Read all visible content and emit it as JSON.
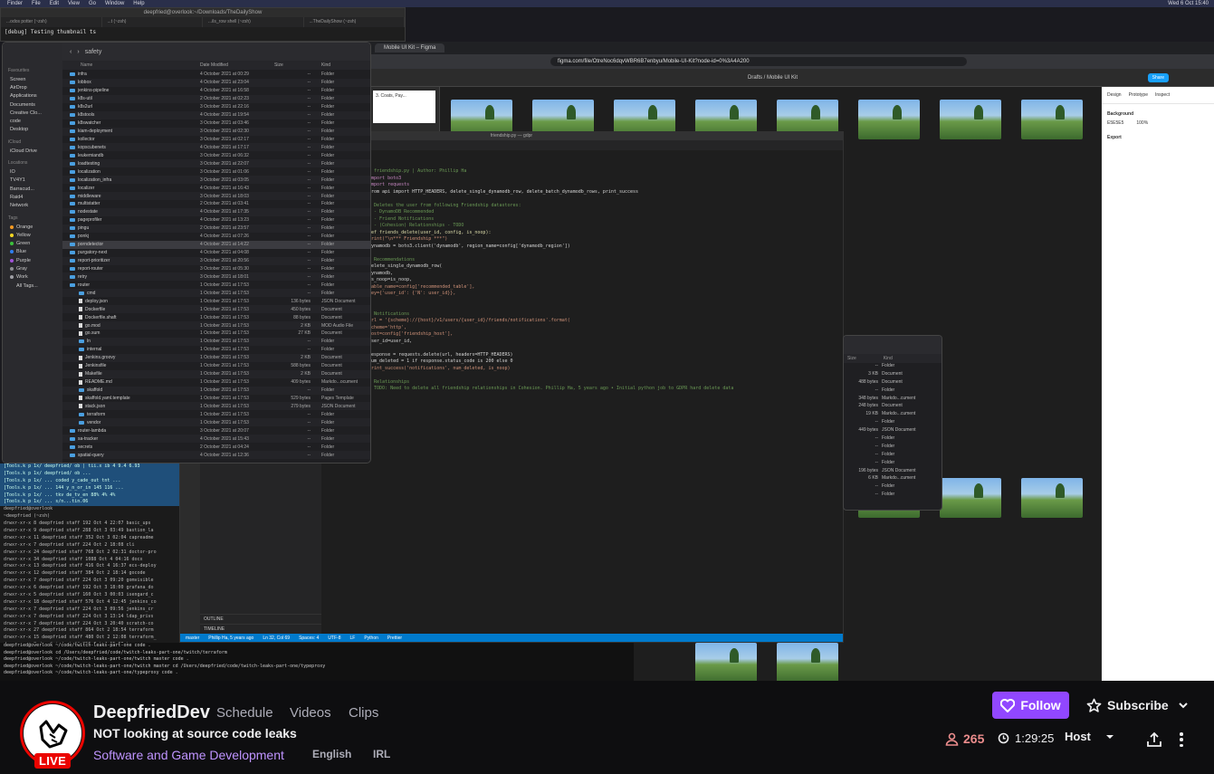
{
  "stream": {
    "menubar": {
      "items": [
        "Finder",
        "File",
        "Edit",
        "View",
        "Go",
        "Window",
        "Help"
      ],
      "clock": "Wed 6 Oct 15:40"
    },
    "terminal_top": {
      "title": "deepfried@overlook:~/Downloads/TheDailyShow",
      "tabs": [
        "...odos  potter (~zsh)",
        "...t (~zsh)",
        "...ils_row  shell (~zsh)",
        "...TheDailyShow (~zsh)"
      ],
      "line": "[debug] Testing thumbnail ts"
    },
    "finder": {
      "folder": "safety",
      "sidebar": {
        "favorites_label": "Favourites",
        "favorites": [
          "Screen",
          "AirDrop",
          "Applications",
          "Documents",
          "Creative Clo...",
          "code",
          "Desktop"
        ],
        "icloud_label": "iCloud",
        "icloud": [
          "iCloud Drive"
        ],
        "locations_label": "Locations",
        "locations": [
          "IO",
          "TV4Y1",
          "Barracud...",
          "Raid4",
          "Network"
        ],
        "tags_label": "Tags",
        "tags": [
          {
            "name": "Orange",
            "color": "#f59a23"
          },
          {
            "name": "Yellow",
            "color": "#f5d623"
          },
          {
            "name": "Green",
            "color": "#3cc13c"
          },
          {
            "name": "Blue",
            "color": "#2f7ff0"
          },
          {
            "name": "Purple",
            "color": "#a052d8"
          },
          {
            "name": "Gray",
            "color": "#8e8e93"
          },
          {
            "name": "Work",
            "color": "#9e9ea4"
          },
          {
            "name": "All Tags...",
            "color": ""
          }
        ]
      },
      "columns": [
        "Name",
        "Date Modified",
        "Size",
        "Kind"
      ],
      "rows": [
        {
          "name": "infra",
          "date": "4 October 2021 at 00:29",
          "size": "--",
          "kind": "Folder",
          "type": "folder"
        },
        {
          "name": "lobbox",
          "date": "4 October 2021 at 23:04",
          "size": "--",
          "kind": "Folder",
          "type": "folder"
        },
        {
          "name": "jenkins-pipeline",
          "date": "4 October 2021 at 16:58",
          "size": "--",
          "kind": "Folder",
          "type": "folder"
        },
        {
          "name": "k8s-util",
          "date": "2 October 2021 at 02:23",
          "size": "--",
          "kind": "Folder",
          "type": "folder"
        },
        {
          "name": "k8s2url",
          "date": "3 October 2021 at 22:16",
          "size": "--",
          "kind": "Folder",
          "type": "folder"
        },
        {
          "name": "k8stools",
          "date": "4 October 2021 at 19:54",
          "size": "--",
          "kind": "Folder",
          "type": "folder"
        },
        {
          "name": "k8swatcher",
          "date": "3 October 2021 at 03:46",
          "size": "--",
          "kind": "Folder",
          "type": "folder"
        },
        {
          "name": "kiam-deployment",
          "date": "3 October 2021 at 02:30",
          "size": "--",
          "kind": "Folder",
          "type": "folder"
        },
        {
          "name": "kollector",
          "date": "3 October 2021 at 02:17",
          "size": "--",
          "kind": "Folder",
          "type": "folder"
        },
        {
          "name": "kopscubenets",
          "date": "4 October 2021 at 17:17",
          "size": "--",
          "kind": "Folder",
          "type": "folder"
        },
        {
          "name": "leukemiandb",
          "date": "3 October 2021 at 06:32",
          "size": "--",
          "kind": "Folder",
          "type": "folder"
        },
        {
          "name": "loadtesting",
          "date": "3 October 2021 at 22:07",
          "size": "--",
          "kind": "Folder",
          "type": "folder"
        },
        {
          "name": "localization",
          "date": "3 October 2021 at 01:06",
          "size": "--",
          "kind": "Folder",
          "type": "folder"
        },
        {
          "name": "localization_infra",
          "date": "3 October 2021 at 03:05",
          "size": "--",
          "kind": "Folder",
          "type": "folder"
        },
        {
          "name": "localizer",
          "date": "4 October 2021 at 16:43",
          "size": "--",
          "kind": "Folder",
          "type": "folder"
        },
        {
          "name": "middleware",
          "date": "3 October 2021 at 18:03",
          "size": "--",
          "kind": "Folder",
          "type": "folder"
        },
        {
          "name": "multistatter",
          "date": "2 October 2021 at 03:41",
          "size": "--",
          "kind": "Folder",
          "type": "folder"
        },
        {
          "name": "nodestate",
          "date": "4 October 2021 at 17:35",
          "size": "--",
          "kind": "Folder",
          "type": "folder"
        },
        {
          "name": "pageprofiler",
          "date": "4 October 2021 at 13:23",
          "size": "--",
          "kind": "Folder",
          "type": "folder"
        },
        {
          "name": "pingu",
          "date": "2 October 2021 at 23:57",
          "size": "--",
          "kind": "Folder",
          "type": "folder"
        },
        {
          "name": "ponkj",
          "date": "4 October 2021 at 07:26",
          "size": "--",
          "kind": "Folder",
          "type": "folder"
        },
        {
          "name": "porndetector",
          "date": "4 October 2021 at 14:22",
          "size": "--",
          "kind": "Folder",
          "type": "folder"
        },
        {
          "name": "purgatory-next",
          "date": "4 October 2021 at 04:08",
          "size": "--",
          "kind": "Folder",
          "type": "folder"
        },
        {
          "name": "report-prioritizer",
          "date": "3 October 2021 at 20:56",
          "size": "--",
          "kind": "Folder",
          "type": "folder"
        },
        {
          "name": "report-router",
          "date": "3 October 2021 at 05:30",
          "size": "--",
          "kind": "Folder",
          "type": "folder"
        },
        {
          "name": "retry",
          "date": "3 October 2021 at 18:01",
          "size": "--",
          "kind": "Folder",
          "type": "folder"
        },
        {
          "name": "router",
          "date": "1 October 2021 at 17:53",
          "size": "--",
          "kind": "Folder",
          "type": "folder"
        },
        {
          "name": "cmd",
          "date": "1 October 2021 at 17:53",
          "size": "--",
          "kind": "Folder",
          "type": "folder",
          "indent": 1
        },
        {
          "name": "deploy.json",
          "date": "1 October 2021 at 17:53",
          "size": "136 bytes",
          "kind": "JSON Document",
          "type": "file",
          "indent": 1
        },
        {
          "name": "Dockerfile",
          "date": "1 October 2021 at 17:53",
          "size": "450 bytes",
          "kind": "Document",
          "type": "file",
          "indent": 1
        },
        {
          "name": "Dockerfile.shaft",
          "date": "1 October 2021 at 17:53",
          "size": "88 bytes",
          "kind": "Document",
          "type": "file",
          "indent": 1
        },
        {
          "name": "go.mod",
          "date": "1 October 2021 at 17:53",
          "size": "2 KB",
          "kind": "MOD Audio File",
          "type": "file",
          "indent": 1
        },
        {
          "name": "go.sum",
          "date": "1 October 2021 at 17:53",
          "size": "27 KB",
          "kind": "Document",
          "type": "file",
          "indent": 1
        },
        {
          "name": "ln",
          "date": "1 October 2021 at 17:53",
          "size": "--",
          "kind": "Folder",
          "type": "folder",
          "indent": 1
        },
        {
          "name": "internal",
          "date": "1 October 2021 at 17:53",
          "size": "--",
          "kind": "Folder",
          "type": "folder",
          "indent": 1
        },
        {
          "name": "Jenkins.groovy",
          "date": "1 October 2021 at 17:53",
          "size": "2 KB",
          "kind": "Document",
          "type": "file",
          "indent": 1
        },
        {
          "name": "Jenkinsfile",
          "date": "1 October 2021 at 17:53",
          "size": "588 bytes",
          "kind": "Document",
          "type": "file",
          "indent": 1
        },
        {
          "name": "Makefile",
          "date": "1 October 2021 at 17:53",
          "size": "2 KB",
          "kind": "Document",
          "type": "file",
          "indent": 1
        },
        {
          "name": "README.md",
          "date": "1 October 2021 at 17:53",
          "size": "409 bytes",
          "kind": "Markdo...ocument",
          "type": "file",
          "indent": 1
        },
        {
          "name": "skaffold",
          "date": "1 October 2021 at 17:53",
          "size": "--",
          "kind": "Folder",
          "type": "folder",
          "indent": 1
        },
        {
          "name": "skaffold.yaml.template",
          "date": "1 October 2021 at 17:53",
          "size": "529 bytes",
          "kind": "Pages Template",
          "type": "file",
          "indent": 1
        },
        {
          "name": "stack.json",
          "date": "1 October 2021 at 17:53",
          "size": "279 bytes",
          "kind": "JSON Document",
          "type": "file",
          "indent": 1
        },
        {
          "name": "terraform",
          "date": "1 October 2021 at 17:53",
          "size": "--",
          "kind": "Folder",
          "type": "folder",
          "indent": 1
        },
        {
          "name": "vendor",
          "date": "1 October 2021 at 17:53",
          "size": "--",
          "kind": "Folder",
          "type": "folder",
          "indent": 1
        },
        {
          "name": "router-lambda",
          "date": "3 October 2021 at 20:07",
          "size": "--",
          "kind": "Folder",
          "type": "folder"
        },
        {
          "name": "sa-tracker",
          "date": "4 October 2021 at 15:43",
          "size": "--",
          "kind": "Folder",
          "type": "folder"
        },
        {
          "name": "secrets",
          "date": "2 October 2021 at 04:24",
          "size": "--",
          "kind": "Folder",
          "type": "folder"
        },
        {
          "name": "spatial-query",
          "date": "4 October 2021 at 12:36",
          "size": "--",
          "kind": "Folder",
          "type": "folder"
        }
      ]
    },
    "terminal_low": {
      "lines": [
        "[Tools.k p 1x/ deepfried/ ob  |  tii.x  ib 4  9.4  6.93",
        "[Tools.k p 1x/ deepfried/ ob ...",
        "[Tools.k p 1x/ ... coded y_cade_out tnt ...",
        "[Tools.k p 1x/ ... 144 y_n_or_in 145 116 ...",
        "[Tools.k p 1x/ ... tkv de_tv_en 88% 4% 4%",
        "[Tools.k p 1x/ ... s/n...tin.06",
        "deepfried@overlook",
        "~deepfried (~zsh)",
        "drwxr-xr-x  8 deepfried staff  192 Oct  4 22:07 basic_ups",
        "drwxr-xr-x  9 deepfried staff  288 Oct  3 03:49 bastion_la",
        "drwxr-xr-x 11 deepfried staff  352 Oct  3 02:04 capreadme",
        "drwxr-xr-x  7 deepfried staff  224 Oct  2 18:08 cli",
        "drwxr-xr-x 24 deepfried staff  768 Oct  2 02:31 doctor-pro",
        "drwxr-xr-x 34 deepfried staff 1088 Oct  4 04:16 docx",
        "drwxr-xr-x 13 deepfried staff  416 Oct  4 16:37 ecs-deploy",
        "drwxr-xr-x 12 deepfried staff  384 Oct  2 18:14 gocode",
        "drwxr-xr-x  7 deepfried staff  224 Oct  3 09:20 gomvisible",
        "drwxr-xr-x  6 deepfried staff  192 Oct  3 18:00 grafana_do",
        "drwxr-xr-x  5 deepfried staff  160 Oct  3 00:03 isengard_c",
        "drwxr-xr-x 18 deepfried staff  576 Oct  4 12:45 jenkins_co",
        "drwxr-xr-x  7 deepfried staff  224 Oct  3 09:56 jenkins_cr",
        "drwxr-xr-x  7 deepfried staff  224 Oct  3 13:14 ldap_privs",
        "drwxr-xr-x  7 deepfried staff  224 Oct  3 20:40 scratch-co",
        "drwxr-xr-x 27 deepfried staff  864 Oct  2 18:54 terraform",
        "drwxr-xr-x 15 deepfried staff  480 Oct  2 12:08 terraform_",
        "drwxr-xr-x  8 deepfried staff  256 Oct  4 15:09 typeproxy"
      ]
    },
    "chrome": {
      "tab_title": "Mobile UI Kit – Figma",
      "url": "figma.com/file/OtreNoc6dqvWBR6B7enbyu/Mobile-UI-Kit?node-id=0%3A4A200",
      "figma_crumb": "Drafts / Mobile UI Kit",
      "share": "Share",
      "panel_tabs": [
        "Design",
        "Prototype",
        "Inspect"
      ],
      "background_label": "Background",
      "background_value": "E5E5E5",
      "background_pct": "100%",
      "export_label": "Export",
      "card_label": "3. Coats, Pay..."
    },
    "vscode": {
      "title": "friendship.py — gdpr",
      "code": [
        {
          "t": "c",
          "v": "# friendship.py | Author: Phillip Ha"
        },
        {
          "t": "k",
          "v": "import boto3"
        },
        {
          "t": "k",
          "v": "import requests"
        },
        {
          "t": "n",
          "v": "from api import HTTP_HEADERS, delete_single_dynamodb_row, delete_batch_dynamodb_rows, print_success"
        },
        {
          "t": "n",
          "v": ""
        },
        {
          "t": "c",
          "v": "# Deletes the user from following Friendship datastores:"
        },
        {
          "t": "c",
          "v": "#  - DynamoDB Recommended"
        },
        {
          "t": "c",
          "v": "#  - Friend Notifications"
        },
        {
          "t": "c",
          "v": "#  - (Cohesion) Relationships - TODO"
        },
        {
          "t": "f",
          "v": "def friends_delete(user_id, config, is_noop):"
        },
        {
          "t": "s",
          "v": "    print(\"\\n*** Friendship ***\")"
        },
        {
          "t": "n",
          "v": "    dynamodb = boto3.client('dynamodb', region_name=config['dynamodb_region'])"
        },
        {
          "t": "n",
          "v": ""
        },
        {
          "t": "c",
          "v": "    # Recommendations"
        },
        {
          "t": "n",
          "v": "    delete_single_dynamodb_row("
        },
        {
          "t": "n",
          "v": "        dynamodb,"
        },
        {
          "t": "n",
          "v": "        is_noop=is_noop,"
        },
        {
          "t": "s",
          "v": "        table_name=config['recommended_table'],"
        },
        {
          "t": "s",
          "v": "        key={'user_id': {'N': user_id}},"
        },
        {
          "t": "n",
          "v": "    )"
        },
        {
          "t": "n",
          "v": ""
        },
        {
          "t": "c",
          "v": "    # Notifications"
        },
        {
          "t": "s",
          "v": "    url = '{scheme}://{host}/v1/users/{user_id}/friends/notifications'.format("
        },
        {
          "t": "s",
          "v": "        scheme='http',"
        },
        {
          "t": "s",
          "v": "        host=config['friendship_host'],"
        },
        {
          "t": "n",
          "v": "        user_id=user_id,"
        },
        {
          "t": "n",
          "v": "    )"
        },
        {
          "t": "n",
          "v": "    response = requests.delete(url, headers=HTTP_HEADERS)"
        },
        {
          "t": "n",
          "v": "    num_deleted = 1 if response.status_code is 200 else 0"
        },
        {
          "t": "s",
          "v": "    print_success('notifications', num_deleted, is_noop)"
        },
        {
          "t": "n",
          "v": ""
        },
        {
          "t": "c",
          "v": "    # Relationships"
        },
        {
          "t": "c",
          "v": "    # TODO: Need to delete all friendship relationships in Cohesion.      Phillip Ha, 5 years ago • Initial python job to GDPR hard delete data"
        }
      ],
      "outline": "OUTLINE",
      "timeline": "TIMELINE",
      "status": [
        "master",
        "Phillip Ha, 5 years ago",
        "Ln 32, Col 69",
        "Spaces: 4",
        "UTF-8",
        "LF",
        "Python",
        "Prettier"
      ]
    },
    "finder2": {
      "columns": [
        "Size",
        "Kind"
      ],
      "rows": [
        {
          "size": "--",
          "kind": "Folder"
        },
        {
          "size": "3 KB",
          "kind": "Document"
        },
        {
          "size": "488 bytes",
          "kind": "Document"
        },
        {
          "size": "--",
          "kind": "Folder"
        },
        {
          "size": "348 bytes",
          "kind": "Markdo...cument"
        },
        {
          "size": "248 bytes",
          "kind": "Document"
        },
        {
          "size": "19 KB",
          "kind": "Markdo...cument"
        },
        {
          "size": "--",
          "kind": "Folder"
        },
        {
          "size": "449 bytes",
          "kind": "JSON Document"
        },
        {
          "size": "--",
          "kind": "Folder"
        },
        {
          "size": "--",
          "kind": "Folder"
        },
        {
          "size": "--",
          "kind": "Folder"
        },
        {
          "size": "--",
          "kind": "Folder"
        },
        {
          "size": "196 bytes",
          "kind": "JSON Document"
        },
        {
          "size": "6 KB",
          "kind": "Markdo...cument"
        },
        {
          "size": "--",
          "kind": "Folder"
        },
        {
          "size": "--",
          "kind": "Folder"
        }
      ]
    },
    "terminal_bottom": {
      "lines": [
        "deepfried@overlook  ~/code/twitch-leaks-part-one    code .",
        "deepfried@overlook  cd /Users/deepfried/code/twitch-leaks-part-one/twitch/terraform",
        "deepfried@overlook  ~/code/twitch-leaks-part-one/twitch  master  code .",
        "deepfried@overlook  ~/code/twitch-leaks-part-one/twitch  master  cd /Users/deepfried/code/twitch-leaks-part-one/typeproxy",
        "deepfried@overlook  ~/code/twitch-leaks-part-one/typeproxy  code ."
      ]
    }
  },
  "info": {
    "live_badge": "LIVE",
    "channel_name": "DeepfriedDev",
    "nav": [
      "Schedule",
      "Videos",
      "Clips"
    ],
    "stream_title": "NOT looking at source code leaks",
    "category": "Software and Game Development",
    "tags": [
      "English",
      "IRL"
    ],
    "follow_label": "Follow",
    "subscribe_label": "Subscribe",
    "viewer_count": "265",
    "uptime": "1:29:25",
    "host_label": "Host",
    "accent": "#9147ff",
    "live_color": "#eb0400"
  }
}
